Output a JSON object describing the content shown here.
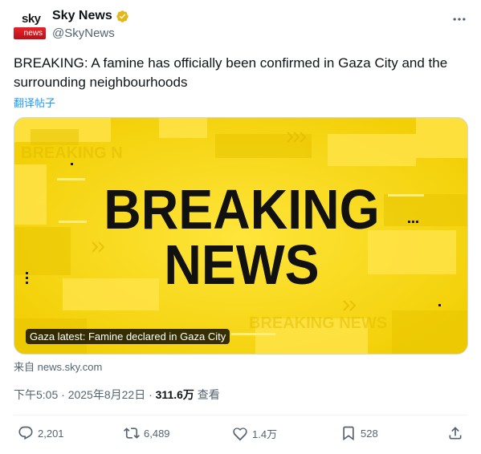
{
  "author": {
    "avatar_top": "sky",
    "avatar_bottom": "news",
    "name": "Sky News",
    "handle": "@SkyNews"
  },
  "tweet": {
    "text": "BREAKING: A famine has officially been confirmed in Gaza City and the surrounding neighbourhoods",
    "translate_label": "翻译帖子"
  },
  "card": {
    "headline_line1": "BREAKING",
    "headline_line2": "NEWS",
    "watermark_top": "BREAKING N",
    "watermark_bottom": "BREAKING NEWS",
    "caption": "Gaza latest: Famine declared in Gaza City",
    "source": "来自 news.sky.com",
    "bg_color": "#f5d60f"
  },
  "meta": {
    "time": "下午5:05 · 2025年8月22日 · ",
    "views": "311.6万",
    "views_label": " 查看"
  },
  "actions": {
    "replies": "2,201",
    "reposts": "6,489",
    "likes": "1.4万",
    "bookmarks": "528"
  },
  "icons": [
    "verified-badge-icon",
    "more-options-icon",
    "reply-icon",
    "repost-icon",
    "like-icon",
    "bookmark-icon",
    "share-icon"
  ]
}
